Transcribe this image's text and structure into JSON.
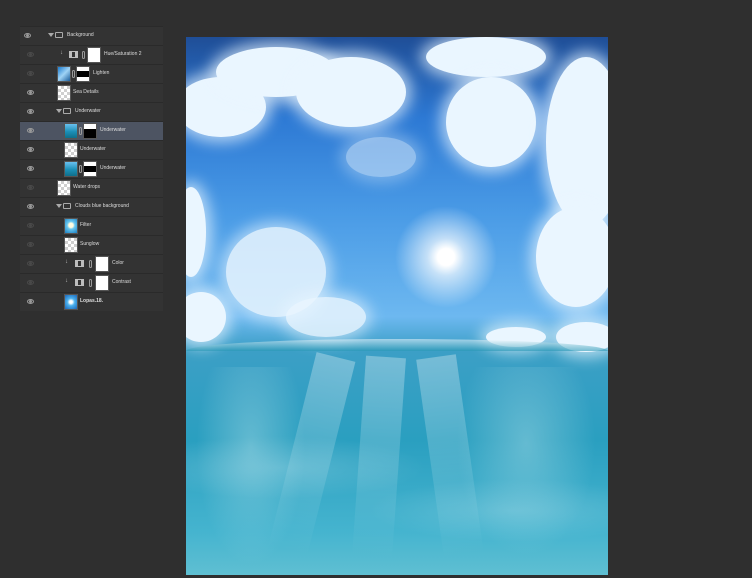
{
  "layers": [
    {
      "name": "Background",
      "type": "group",
      "visible": true,
      "expanded": true,
      "level": 0
    },
    {
      "name": "Hue/Saturation 2",
      "type": "adjustment",
      "visible": false,
      "clipped": true,
      "level": 1,
      "icon": "hue-saturation-icon"
    },
    {
      "name": "Lighten",
      "type": "layer",
      "visible": false,
      "level": 1,
      "masked": true
    },
    {
      "name": "Sea Details",
      "type": "layer",
      "visible": true,
      "level": 1
    },
    {
      "name": "Underwater",
      "type": "group",
      "visible": true,
      "expanded": true,
      "level": 1
    },
    {
      "name": "Underwater",
      "type": "layer",
      "visible": true,
      "selected": true,
      "level": 2,
      "masked": true
    },
    {
      "name": "Underwater",
      "type": "layer",
      "visible": true,
      "level": 2
    },
    {
      "name": "Underwater",
      "type": "layer",
      "visible": true,
      "level": 2,
      "masked": true
    },
    {
      "name": "Water drops",
      "type": "layer",
      "visible": false,
      "level": 1
    },
    {
      "name": "Clouds blue background",
      "type": "group",
      "visible": true,
      "expanded": true,
      "level": 1
    },
    {
      "name": "Filter",
      "type": "layer",
      "visible": false,
      "level": 2
    },
    {
      "name": "Sunglow",
      "type": "layer",
      "visible": false,
      "level": 2
    },
    {
      "name": "Color",
      "type": "adjustment",
      "visible": false,
      "clipped": true,
      "level": 2,
      "icon": "levels-icon"
    },
    {
      "name": "Contrast",
      "type": "adjustment",
      "visible": false,
      "clipped": true,
      "level": 2,
      "icon": "curves-icon"
    },
    {
      "name": "Lopas.18.",
      "type": "layer",
      "visible": true,
      "level": 2
    }
  ],
  "colors": {
    "workspace": "#2f2f2f",
    "panel": "#333333",
    "selected_row": "#4d5462",
    "text": "#dcdcdc"
  }
}
